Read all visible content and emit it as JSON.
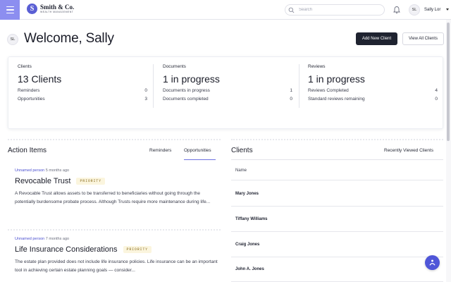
{
  "header": {
    "logo_name": "Smith & Co.",
    "logo_sub": "WEALTH MANAGEMENT",
    "logo_mark": "S",
    "search_placeholder": "Search",
    "user_initials": "SL",
    "user_name": "Sally Lor",
    "icons": [
      "menu-icon",
      "search-icon",
      "bell-icon",
      "caret-down-icon"
    ],
    "accent_color": "#8c8ef0"
  },
  "welcome": {
    "initials": "SL",
    "title": "Welcome, Sally",
    "add_client_label": "Add New Client",
    "view_clients_label": "View All Clients"
  },
  "stats": {
    "clients": {
      "label": "Clients",
      "big": "13 Clients",
      "rows": [
        {
          "label": "Reminders",
          "value": "0"
        },
        {
          "label": "Opportunities",
          "value": "3"
        }
      ]
    },
    "documents": {
      "label": "Documents",
      "big": "1 in progress",
      "rows": [
        {
          "label": "Documents in progress",
          "value": "1"
        },
        {
          "label": "Documents completed",
          "value": "0"
        }
      ]
    },
    "reviews": {
      "label": "Reviews",
      "big": "1 in progress",
      "rows": [
        {
          "label": "Reviews Completed",
          "value": "4"
        },
        {
          "label": "Standard reviews remaining",
          "value": "0"
        }
      ]
    }
  },
  "action_items": {
    "title": "Action Items",
    "tabs": [
      "Reminders",
      "Opportunities"
    ],
    "active_tab": "Opportunities",
    "items": [
      {
        "who": "Unnamed person",
        "when": "5 months ago",
        "title": "Revocable Trust",
        "badge": "PRIORITY",
        "desc": "A Revocable Trust allows assets to be transferred to beneficiaries without going through the potentially burdensome probate process. Although Trusts require more maintenance during life..."
      },
      {
        "who": "Unnamed person",
        "when": "7 months ago",
        "title": "Life Insurance Considerations",
        "badge": "PRIORITY",
        "desc": "The estate plan provided does not include life insurance policies. Life insurance can be an important tool in achieving certain estate planning goals — consider..."
      }
    ]
  },
  "clients": {
    "title": "Clients",
    "tab": "Recently Viewed Clients",
    "column": "Name",
    "rows": [
      "Mary Jones",
      "Tiffany Williams",
      "Craig Jones",
      "John A. Jones"
    ]
  },
  "colors": {
    "primary_button": "#1f2330",
    "link": "#4a4fd0",
    "badge_bg": "#fbf5de",
    "fab": "#4f56d8"
  }
}
